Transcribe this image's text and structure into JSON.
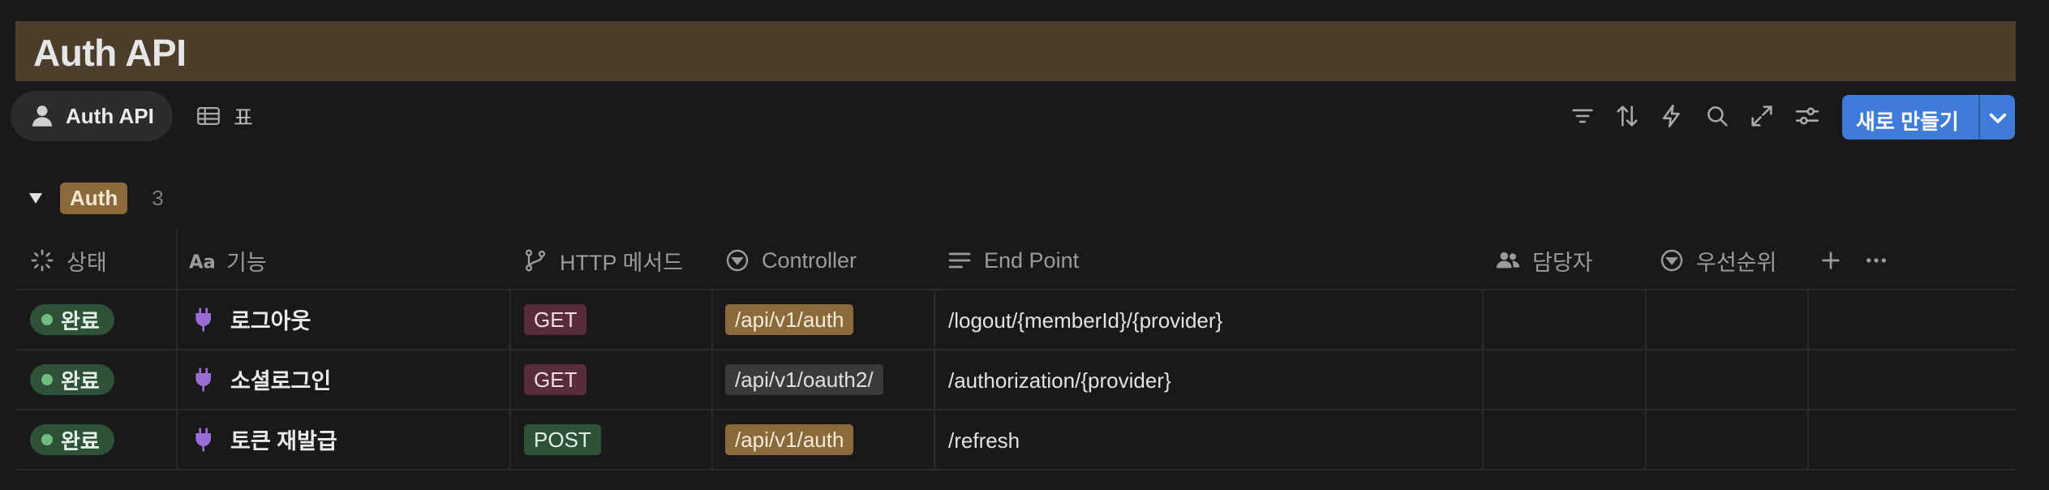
{
  "page": {
    "title": "Auth API"
  },
  "views": [
    {
      "label": "Auth API",
      "icon": "person-icon",
      "active": true
    },
    {
      "label": "표",
      "icon": "table-icon",
      "active": false
    }
  ],
  "toolbar": {
    "icons": [
      "filter-icon",
      "sort-icon",
      "lightning-icon",
      "search-icon",
      "expand-icon",
      "settings-sliders-icon"
    ],
    "new_button_label": "새로 만들기",
    "new_button_color": "#3f7bd8"
  },
  "group": {
    "label": "Auth",
    "count": "3",
    "badge_color": "#8a6a3a"
  },
  "columns": [
    {
      "label": "상태",
      "icon": "status-spinner-icon"
    },
    {
      "label": "기능",
      "icon": "text-aa-icon"
    },
    {
      "label": "HTTP 메서드",
      "icon": "branch-icon"
    },
    {
      "label": "Controller",
      "icon": "select-circle-icon"
    },
    {
      "label": "End Point",
      "icon": "lines-icon"
    },
    {
      "label": "담당자",
      "icon": "people-icon"
    },
    {
      "label": "우선순위",
      "icon": "select-circle-icon"
    }
  ],
  "rows": [
    {
      "status": "완료",
      "feature": "로그아웃",
      "method": "GET",
      "method_color": "#5a2a3d",
      "controller": "/api/v1/auth",
      "controller_color": "#8a6a3a",
      "endpoint": "/logout/{memberId}/{provider}"
    },
    {
      "status": "완료",
      "feature": "소셜로그인",
      "method": "GET",
      "method_color": "#5a2a3d",
      "controller": "/api/v1/oauth2/",
      "controller_color": "#3a3a3a",
      "endpoint": "/authorization/{provider}"
    },
    {
      "status": "완료",
      "feature": "토큰 재발급",
      "method": "POST",
      "method_color": "#2f5137",
      "controller": "/api/v1/auth",
      "controller_color": "#8a6a3a",
      "endpoint": "/refresh"
    }
  ],
  "colors": {
    "status_done": "#2f5137",
    "status_dot": "#6ebd7c",
    "plug_icon": "#9b6cd6"
  }
}
